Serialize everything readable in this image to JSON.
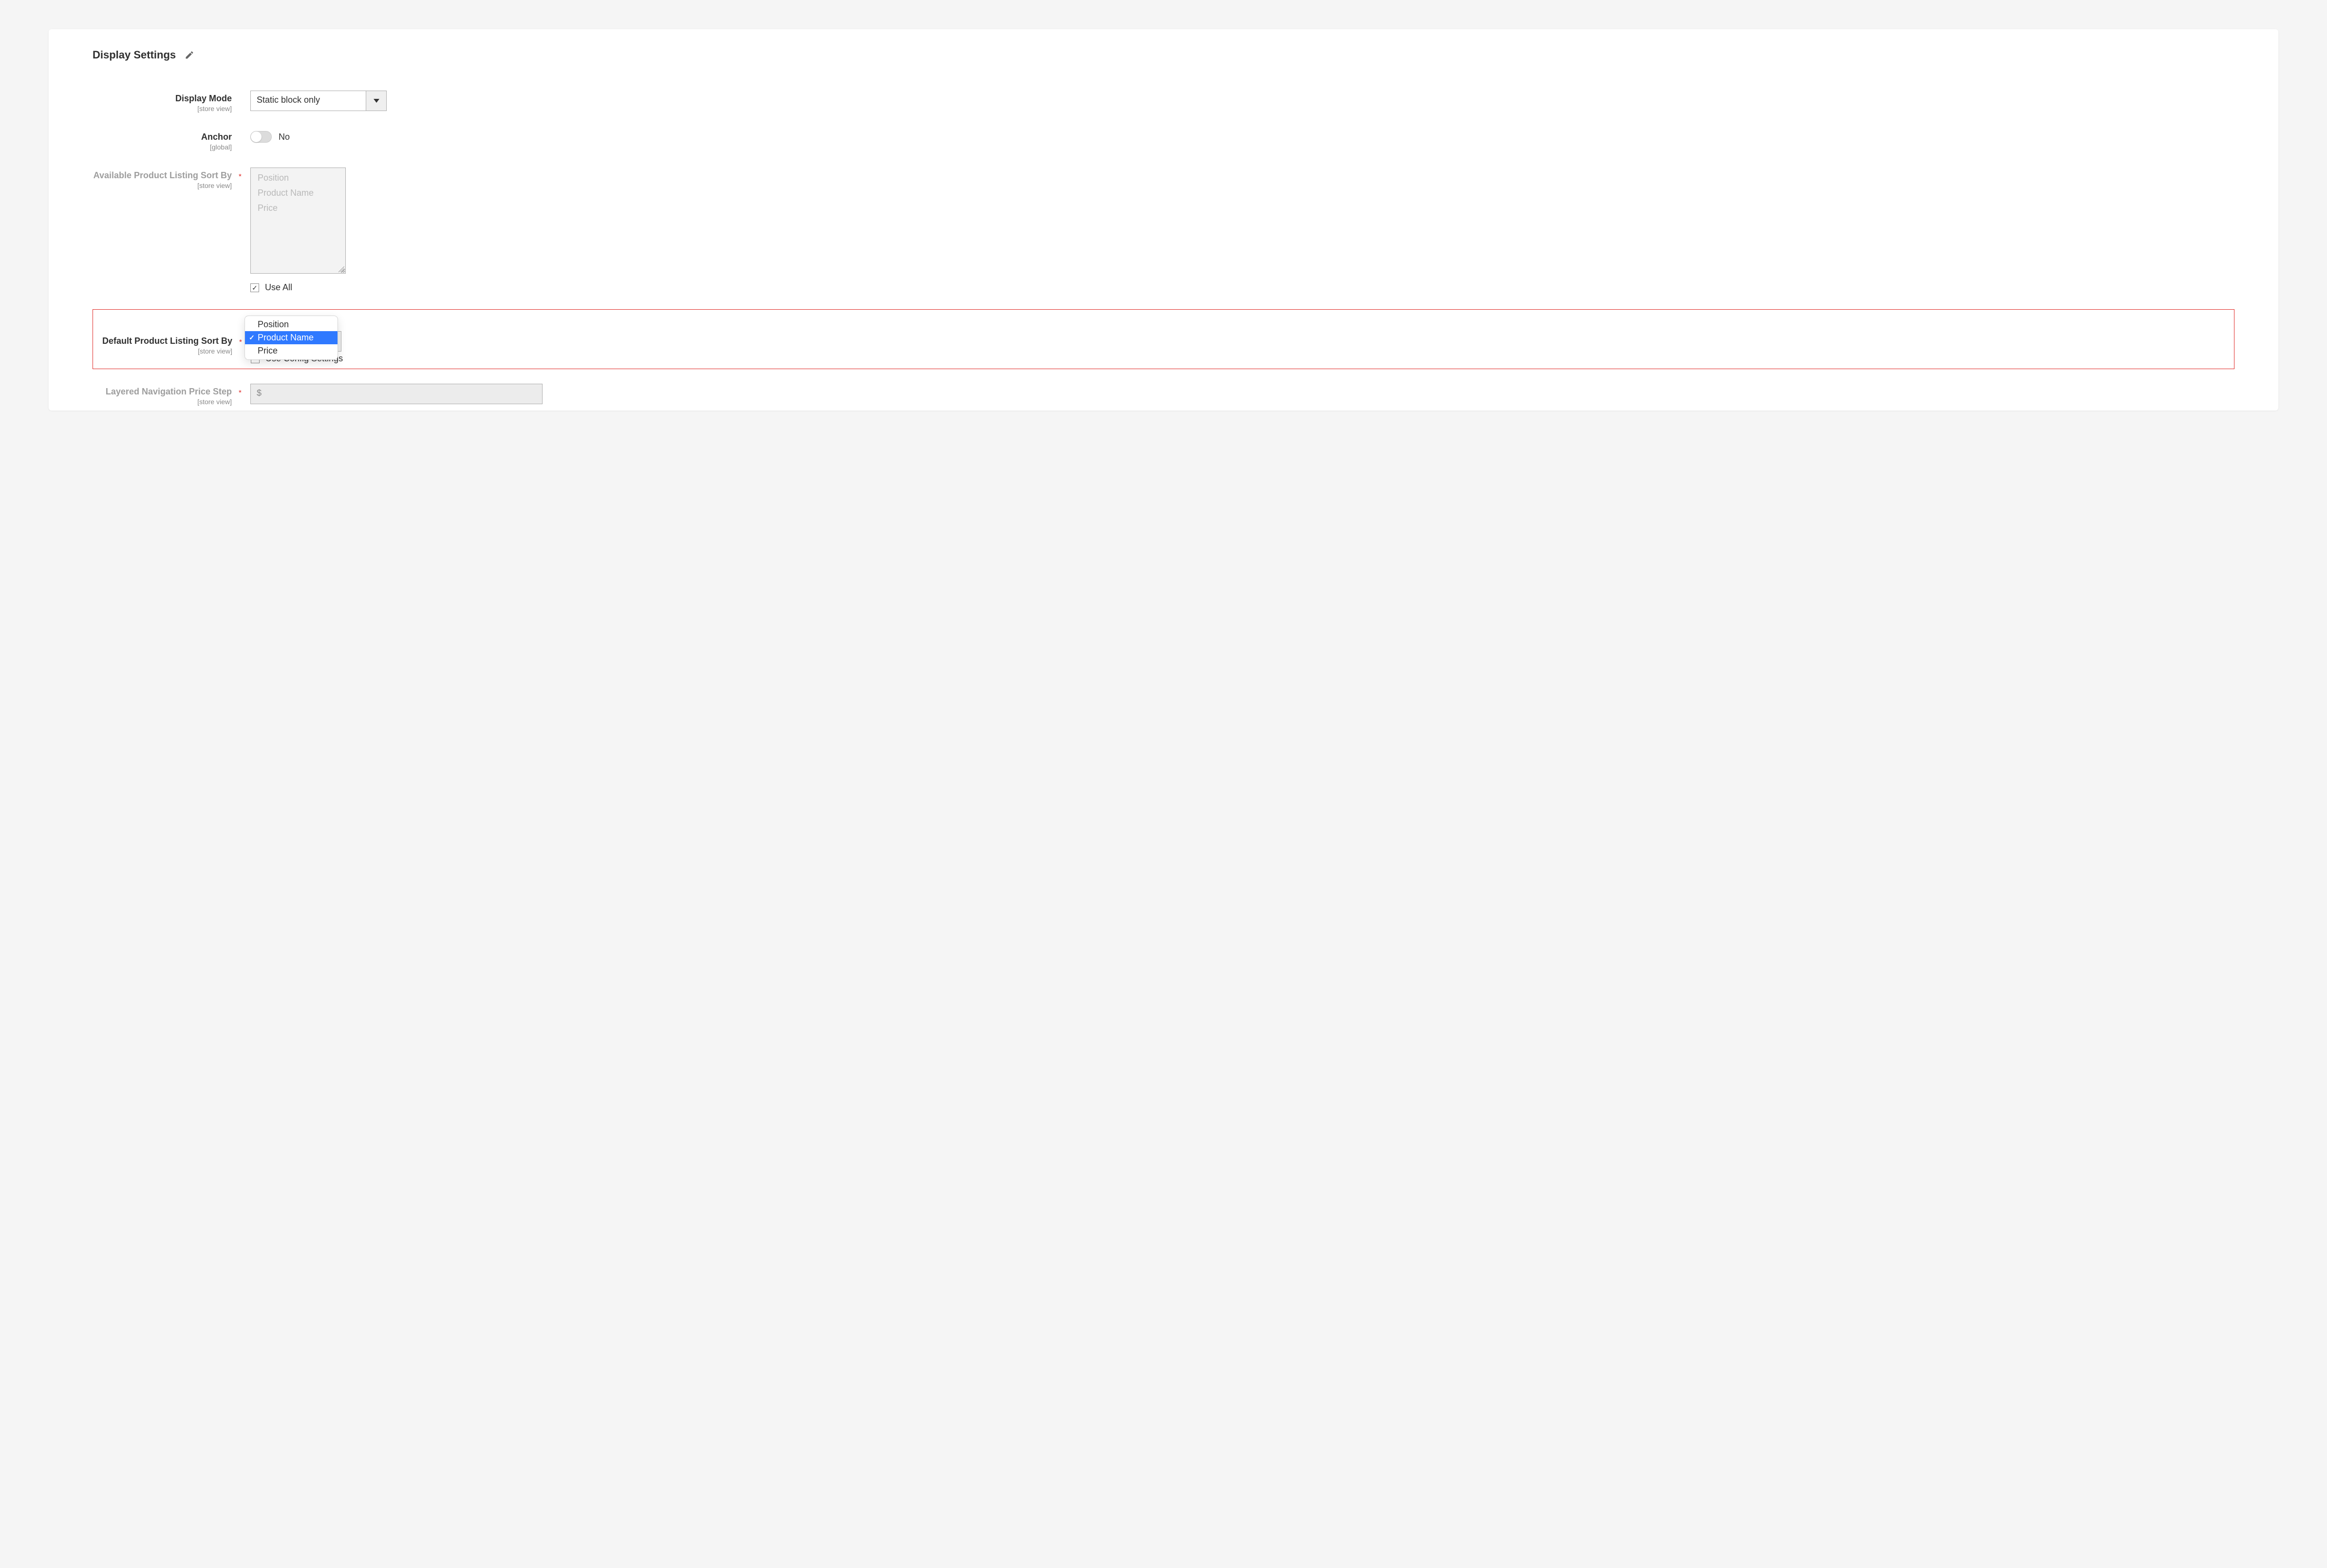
{
  "section": {
    "title": "Display Settings"
  },
  "scope": {
    "store_view": "[store view]",
    "global": "[global]"
  },
  "required_mark": "*",
  "display_mode": {
    "label": "Display Mode",
    "value": "Static block only"
  },
  "anchor": {
    "label": "Anchor",
    "value": "No"
  },
  "available_sort": {
    "label": "Available Product Listing Sort By",
    "options": {
      "position": "Position",
      "product_name": "Product Name",
      "price": "Price"
    },
    "use_all_label": "Use All",
    "use_all_checked": true
  },
  "default_sort": {
    "label": "Default Product Listing Sort By",
    "options": {
      "position": "Position",
      "product_name": "Product Name",
      "price": "Price"
    },
    "selected": "Product Name",
    "use_config_label": "Use Config Settings",
    "use_config_checked": false
  },
  "price_step": {
    "label": "Layered Navigation Price Step",
    "prefix": "$"
  }
}
